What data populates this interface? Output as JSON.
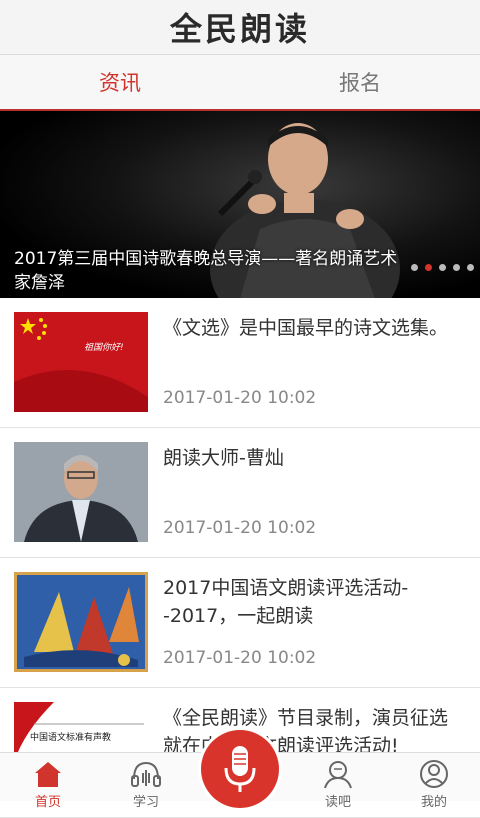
{
  "header": {
    "title": "全民朗读"
  },
  "tabs": [
    {
      "label": "资讯",
      "active": true
    },
    {
      "label": "报名",
      "active": false
    }
  ],
  "banner": {
    "caption": "2017第三届中国诗歌春晚总导演——著名朗诵艺术家詹泽",
    "dots": 5,
    "active_dot": 1
  },
  "articles": [
    {
      "title": "《文选》是中国最早的诗文选集。",
      "time": "2017-01-20  10:02",
      "thumb_text": "祖国你好!"
    },
    {
      "title": "朗读大师-曹灿",
      "time": "2017-01-20  10:02"
    },
    {
      "title": "2017中国语文朗读评选活动--2017，一起朗读",
      "time": "2017-01-20  10:02"
    },
    {
      "title": "《全民朗读》节目录制，演员征选就在中国语文朗读评选活动!",
      "time": "",
      "thumb_text": "中国语文标准有声教"
    }
  ],
  "tabbar": {
    "items": [
      {
        "label": "首页",
        "icon": "home-icon",
        "active": true
      },
      {
        "label": "学习",
        "icon": "headphones-icon",
        "active": false
      },
      {
        "label": "",
        "icon": "microphone-icon",
        "active": false
      },
      {
        "label": "读吧",
        "icon": "reader-icon",
        "active": false
      },
      {
        "label": "我的",
        "icon": "user-icon",
        "active": false
      }
    ]
  },
  "colors": {
    "accent": "#d0342c",
    "text": "#333333",
    "muted": "#888888"
  }
}
